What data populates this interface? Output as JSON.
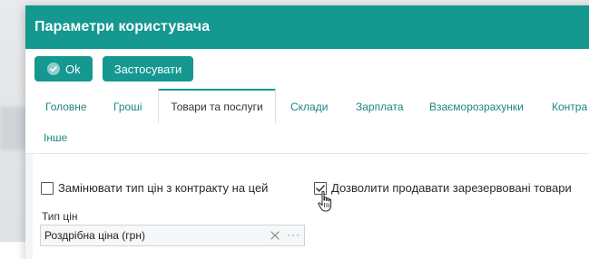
{
  "window": {
    "title": "Параметри користувача"
  },
  "toolbar": {
    "ok_label": "Ok",
    "apply_label": "Застосувати"
  },
  "tabs": [
    {
      "label": "Головне",
      "active": false
    },
    {
      "label": "Гроші",
      "active": false
    },
    {
      "label": "Товари та послуги",
      "active": true
    },
    {
      "label": "Склади",
      "active": false
    },
    {
      "label": "Зарплата",
      "active": false
    },
    {
      "label": "Взаєморозрахунки",
      "active": false
    },
    {
      "label": "Контра",
      "active": false
    },
    {
      "label": "Інше",
      "active": false
    }
  ],
  "form": {
    "replace_price_type": {
      "label": "Замінювати тип цін з контракту на цей",
      "checked": false
    },
    "allow_reserved_sale": {
      "label": "Дозволити продавати зарезервовані товари",
      "checked": true
    },
    "price_type": {
      "label": "Тип цін",
      "value": "Роздрібна ціна (грн)"
    }
  },
  "colors": {
    "accent": "#149890",
    "tab_link": "#1b8780"
  },
  "icons": {
    "ok": "check-circle-icon",
    "clear": "close-icon",
    "more": "ellipsis-icon",
    "cursor": "hand-pointer-icon"
  }
}
